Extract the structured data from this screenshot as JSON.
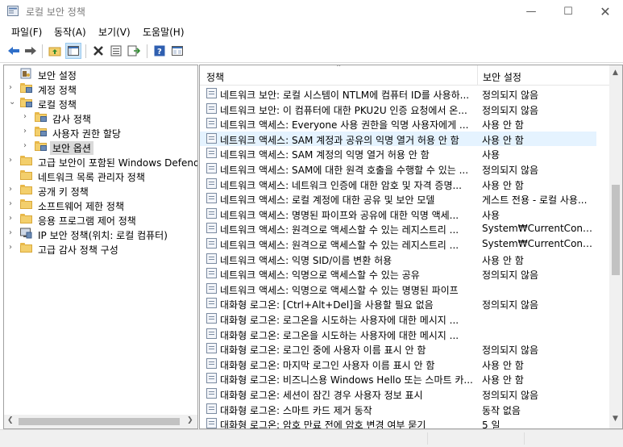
{
  "window": {
    "title": "로컬 보안 정책",
    "minimize_icon": "minimize-icon",
    "maximize_icon": "maximize-icon",
    "close_icon": "close-icon"
  },
  "menu": [
    "파일(F)",
    "동작(A)",
    "보기(V)",
    "도움말(H)"
  ],
  "toolbar": [
    "back-arrow-icon",
    "forward-arrow-icon",
    "up-folder-icon",
    "show-tree-icon",
    "delete-icon",
    "properties-icon",
    "export-icon",
    "help-icon",
    "view-icon"
  ],
  "tree": [
    {
      "label": "보안 설정",
      "arrow": "",
      "icon": "security-settings-icon"
    },
    {
      "label": "계정 정책",
      "arrow": "›",
      "icon": "folder-lock-icon"
    },
    {
      "label": "로컬 정책",
      "arrow": "⌄",
      "icon": "folder-lock-icon"
    },
    {
      "label": "감사 정책",
      "arrow": "›",
      "icon": "folder-lock-icon"
    },
    {
      "label": "사용자 권한 할당",
      "arrow": "›",
      "icon": "folder-lock-icon"
    },
    {
      "label": "보안 옵션",
      "arrow": "›",
      "icon": "folder-lock-icon"
    },
    {
      "label": "고급 보안이 포함된 Windows Defender",
      "arrow": "›",
      "icon": "folder-icon"
    },
    {
      "label": "네트워크 목록 관리자 정책",
      "arrow": "",
      "icon": "folder-icon"
    },
    {
      "label": "공개 키 정책",
      "arrow": "›",
      "icon": "folder-icon"
    },
    {
      "label": "소프트웨어 제한 정책",
      "arrow": "›",
      "icon": "folder-icon"
    },
    {
      "label": "응용 프로그램 제어 정책",
      "arrow": "›",
      "icon": "folder-icon"
    },
    {
      "label": "IP 보안 정책(위치: 로컬 컴퓨터)",
      "arrow": "›",
      "icon": "ip-security-icon"
    },
    {
      "label": "고급 감사 정책 구성",
      "arrow": "›",
      "icon": "folder-icon"
    }
  ],
  "columns": {
    "policy": "정책",
    "setting": "보안 설정"
  },
  "policies": [
    {
      "name": "네트워크 보안: 로컬 시스템이 NTLM에 컴퓨터 ID를 사용하...",
      "value": "정의되지 않음"
    },
    {
      "name": "네트워크 보안: 이 컴퓨터에 대한 PKU2U 인증 요청에서 온...",
      "value": "정의되지 않음"
    },
    {
      "name": "네트워크 액세스: Everyone 사용 권한을 익명 사용자에게 ...",
      "value": "사용 안 함"
    },
    {
      "name": "네트워크 액세스: SAM 계정과 공유의 익명 열거 허용 안 함",
      "value": "사용 안 함"
    },
    {
      "name": "네트워크 액세스: SAM 계정의 익명 열거 허용 안 함",
      "value": "사용"
    },
    {
      "name": "네트워크 액세스: SAM에 대한 원격 호출을 수행할 수 있는 ...",
      "value": "정의되지 않음"
    },
    {
      "name": "네트워크 액세스: 네트워크 인증에 대한 암호 및 자격 증명...",
      "value": "사용 안 함"
    },
    {
      "name": "네트워크 액세스: 로컬 계정에 대한 공유 및 보안 모델",
      "value": "게스트 전용 - 로컬 사용..."
    },
    {
      "name": "네트워크 액세스: 명명된 파이프와 공유에 대한 익명 액세...",
      "value": "사용"
    },
    {
      "name": "네트워크 액세스: 원격으로 액세스할 수 있는 레지스트리 ...",
      "value": "System₩CurrentControl..."
    },
    {
      "name": "네트워크 액세스: 원격으로 액세스할 수 있는 레지스트리 ...",
      "value": "System₩CurrentControl..."
    },
    {
      "name": "네트워크 액세스: 익명 SID/이름 변환 허용",
      "value": "사용 안 함"
    },
    {
      "name": "네트워크 액세스: 익명으로 액세스할 수 있는 공유",
      "value": "정의되지 않음"
    },
    {
      "name": "네트워크 액세스: 익명으로 액세스할 수 있는 명명된 파이프",
      "value": ""
    },
    {
      "name": "대화형 로그온: [Ctrl+Alt+Del]을 사용할 필요 없음",
      "value": "정의되지 않음"
    },
    {
      "name": "대화형 로그온: 로그온을 시도하는 사용자에 대한 메시지 ...",
      "value": ""
    },
    {
      "name": "대화형 로그온: 로그온을 시도하는 사용자에 대한 메시지 ...",
      "value": ""
    },
    {
      "name": "대화형 로그온: 로그인 중에 사용자 이름 표시 안 함",
      "value": "정의되지 않음"
    },
    {
      "name": "대화형 로그온: 마지막 로그인 사용자 이름 표시 안 함",
      "value": "사용 안 함"
    },
    {
      "name": "대화형 로그온: 비즈니스용 Windows Hello 또는 스마트 카...",
      "value": "사용 안 함"
    },
    {
      "name": "대화형 로그온: 세션이 잠긴 경우 사용자 정보 표시",
      "value": "정의되지 않음"
    },
    {
      "name": "대화형 로그온: 스마트 카드 제거 동작",
      "value": "동작 없음"
    },
    {
      "name": "대화형 로그온: 암호 만료 전에 암호 변경 여부 묻기",
      "value": "5 일"
    }
  ],
  "highlighted_row": 3,
  "selected_tree_item": 5
}
